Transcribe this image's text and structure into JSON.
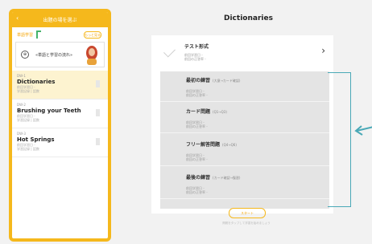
{
  "left_panel": {
    "header_title": "出題の場を選ぶ",
    "back_glyph": "‹",
    "subheader_text": "単語学習",
    "subheader_button": "もっと見る",
    "teach_card": {
      "icon_glyph": "⊕",
      "label": "«単語と学習の流れ»"
    },
    "items": [
      {
        "num": "DW-1",
        "title": "Dictionaries",
        "meta1": "前回学習日 -",
        "meta2": "学習記録  |  話数"
      },
      {
        "num": "DW-2",
        "title": "Brushing your Teeth",
        "meta1": "前回学習日 -",
        "meta2": "学習記録  |  話数"
      },
      {
        "num": "DW-3",
        "title": "Hot Springs",
        "meta1": "前回学習日 -",
        "meta2": "学習記録  |  話数"
      }
    ]
  },
  "main": {
    "title": "Dictionaries",
    "test_card": {
      "title": "テスト形式",
      "meta1": "前回学習日 -",
      "meta2": "前回の正答率 -",
      "chevron": "›"
    },
    "rows": [
      {
        "title": "最初の練習",
        "hint": "(大意→カード確認)",
        "meta1": "前回学習日 -",
        "meta2": "前回の正答率 -"
      },
      {
        "title": "カード問題",
        "hint": "(Q1→Q3)",
        "meta1": "前回学習日 -",
        "meta2": "前回の正答率 -"
      },
      {
        "title": "フリー解答問題",
        "hint": "(Q4→Q6)",
        "meta1": "前回学習日 -",
        "meta2": "前回の正答率 -"
      },
      {
        "title": "最後の練習",
        "hint": "(カード確認→復習)",
        "meta1": "前回学習日 -",
        "meta2": "前回の正答率 -"
      }
    ],
    "start_button": "スタート",
    "footer_text": "問題をタップして学習を始めましょう"
  },
  "colors": {
    "accent": "#f5b81c",
    "annotation": "#4aa9b7"
  }
}
